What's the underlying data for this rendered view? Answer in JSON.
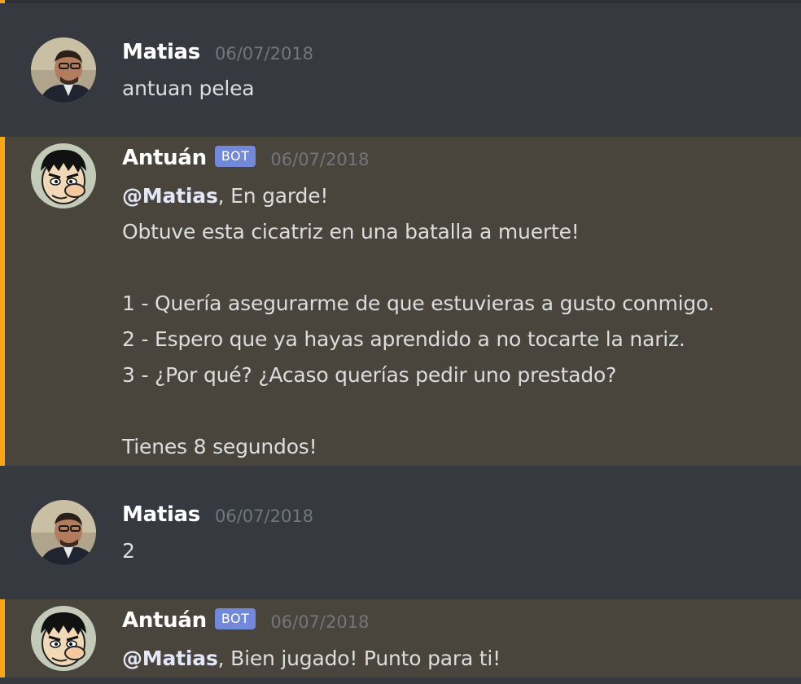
{
  "messages": [
    {
      "author": "Matias",
      "timestamp": "06/07/2018",
      "avatar": "matias-avatar",
      "lines": [
        "antuan pelea"
      ]
    },
    {
      "author": "Antuán",
      "bot_tag": "BOT",
      "timestamp": "06/07/2018",
      "avatar": "antuan-avatar",
      "mention": "@Matias",
      "first_line_rest": ", En garde!",
      "lines": [
        "Obtuve esta cicatriz en una batalla a muerte!",
        "",
        "1 - Quería asegurarme de que estuvieras a gusto conmigo.",
        "2 - Espero que ya hayas aprendido a no tocarte la nariz.",
        "3 - ¿Por qué? ¿Acaso querías pedir uno prestado?",
        "",
        "Tienes 8 segundos!"
      ]
    },
    {
      "author": "Matias",
      "timestamp": "06/07/2018",
      "avatar": "matias-avatar",
      "lines": [
        "2"
      ]
    },
    {
      "author": "Antuán",
      "bot_tag": "BOT",
      "timestamp": "06/07/2018",
      "avatar": "antuan-avatar",
      "mention": "@Matias",
      "first_line_rest": ", Bien jugado! Punto para ti!"
    }
  ],
  "colors": {
    "background": "#36393f",
    "mention_highlight": "#49443c",
    "mention_bar": "#faa61a",
    "bot_tag": "#7289da",
    "username": "#ffffff",
    "timestamp": "#72767d",
    "text": "#dcddde"
  }
}
